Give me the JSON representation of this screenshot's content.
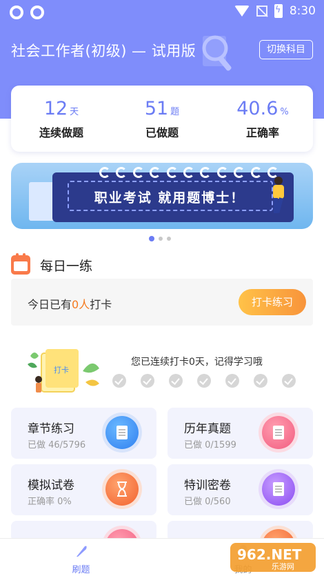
{
  "status_bar": {
    "time": "8:30"
  },
  "header": {
    "title": "社会工作者(初级) — 试用版",
    "switch_button": "切换科目"
  },
  "stats": [
    {
      "value": "12",
      "unit": "天",
      "label": "连续做题"
    },
    {
      "value": "51",
      "unit": "题",
      "label": "已做题"
    },
    {
      "value": "40.6",
      "unit": "%",
      "label": "正确率"
    }
  ],
  "banner": {
    "text": "职业考试 就用题博士！",
    "page_count": 3,
    "active_page": 1
  },
  "daily": {
    "title": "每日一练",
    "checkin_prefix": "今日已有",
    "checkin_count": "0人",
    "checkin_suffix": "打卡",
    "checkin_button": "打卡练习",
    "streak_text": "您已连续打卡0天，记得学习哦",
    "illustration_label": "打卡",
    "days_checked": 0,
    "days_total": 7
  },
  "cards": [
    {
      "title": "章节练习",
      "sub": "已做 46/5796",
      "icon": "document-icon",
      "color": "#2f7ff0"
    },
    {
      "title": "历年真题",
      "sub": "已做 0/1599",
      "icon": "paper-icon",
      "color": "#f25c7f"
    },
    {
      "title": "模拟试卷",
      "sub": "正确率 0%",
      "icon": "hourglass-icon",
      "color": "#f2622e"
    },
    {
      "title": "特训密卷",
      "sub": "已做 0/560",
      "icon": "secret-paper-icon",
      "color": "#8a4cf1"
    }
  ],
  "bottom_nav": [
    {
      "label": "刷题",
      "active": true
    },
    {
      "label": "我的",
      "active": false
    }
  ],
  "watermark": {
    "text": "962.NET",
    "sub": "乐游网"
  }
}
